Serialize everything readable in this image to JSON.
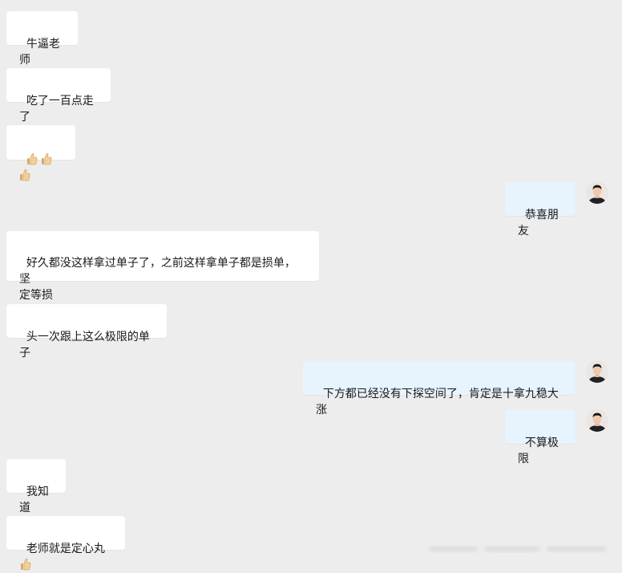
{
  "messages": [
    {
      "side": "left",
      "text": "牛逼老师"
    },
    {
      "side": "left",
      "text": "吃了一百点走了"
    },
    {
      "side": "left",
      "text": "",
      "emoji": [
        "thumbs-up-icon",
        "thumbs-up-icon",
        "thumbs-up-icon"
      ]
    },
    {
      "side": "right",
      "text": "恭喜朋友"
    },
    {
      "side": "left",
      "text": "好久都没这样拿过单子了，之前这样拿单子都是损单，坚\n定等损"
    },
    {
      "side": "left",
      "text": "头一次跟上这么极限的单子"
    },
    {
      "side": "right",
      "text": "下方都已经没有下探空间了，肯定是十拿九稳大涨"
    },
    {
      "side": "right",
      "text": "不算极限"
    },
    {
      "side": "left",
      "text": "我知道"
    },
    {
      "side": "left",
      "text": "老师就是定心丸",
      "emoji": [
        "thumbs-up-icon"
      ]
    }
  ],
  "colors": {
    "background": "#ededed",
    "incoming_bubble": "#ffffff",
    "outgoing_bubble": "#e7f3fd",
    "text": "#1a1a1a"
  }
}
